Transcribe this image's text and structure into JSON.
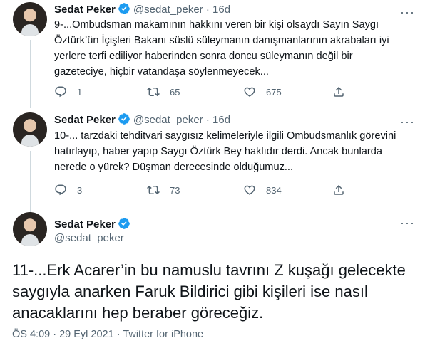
{
  "tweets": [
    {
      "name": "Sedat Peker",
      "handle": "@sedat_peker",
      "dot": "·",
      "time": "16d",
      "more": "···",
      "text": "9-...Ombudsman makamının hakkını veren bir kişi olsaydı Sayın Saygı\nÖztürk’ün İçişleri Bakanı süslü süleymanın danışmanlarının akrabaları iyi\nyerlere terfi ediliyor haberinden sonra doncu süleymanın değil bir\ngazeteciye, hiçbir vatandaşa söylenmeyecek...",
      "replies": "1",
      "retweets": "65",
      "likes": "675"
    },
    {
      "name": "Sedat Peker",
      "handle": "@sedat_peker",
      "dot": "·",
      "time": "16d",
      "more": "···",
      "text": "10-... tarzdaki tehditvari saygısız kelimeleriyle ilgili Ombudsmanlık görevini\nhatırlayıp, haber yapıp Saygı Öztürk Bey haklıdır derdi. Ancak bunlarda\nnerede o yürek? Düşman derecesinde olduğumuz...",
      "replies": "3",
      "retweets": "73",
      "likes": "834"
    }
  ],
  "main": {
    "name": "Sedat Peker",
    "handle": "@sedat_peker",
    "more": "···",
    "text": "11-...Erk Acarer’in bu namuslu tavrını Z kuşağı gelecekte\nsaygıyla anarken Faruk Bildirici gibi kişileri ise nasıl\nanacaklarını  hep beraber göreceğiz.",
    "meta": "ÖS 4:09 · 29 Eyl 2021 · Twitter for iPhone"
  },
  "colors": {
    "verified": "#1d9bf0",
    "secondary_text": "#536471",
    "thread_line": "#cfd9de"
  },
  "icons": [
    "verified-badge-icon",
    "more-options-icon",
    "reply-icon",
    "retweet-icon",
    "like-icon",
    "share-icon"
  ]
}
